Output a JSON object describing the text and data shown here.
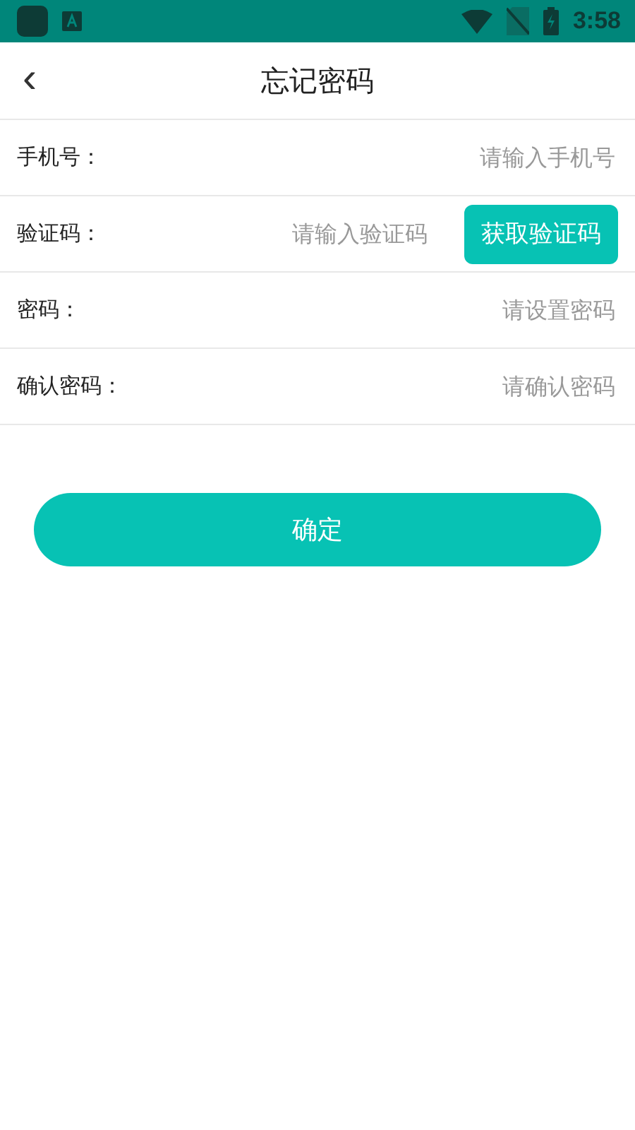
{
  "status_bar": {
    "time": "3:58"
  },
  "header": {
    "back": "‹",
    "title": "忘记密码"
  },
  "fields": [
    {
      "kind": "plain",
      "label": "手机号：",
      "placeholder": "请输入手机号"
    },
    {
      "kind": "code",
      "label": "验证码：",
      "placeholder": "请输入验证码",
      "button": "获取验证码"
    },
    {
      "kind": "plain",
      "label": "密码：",
      "placeholder": "请设置密码"
    },
    {
      "kind": "plain",
      "label": "确认密码：",
      "placeholder": "请确认密码"
    }
  ],
  "submit": "确定"
}
